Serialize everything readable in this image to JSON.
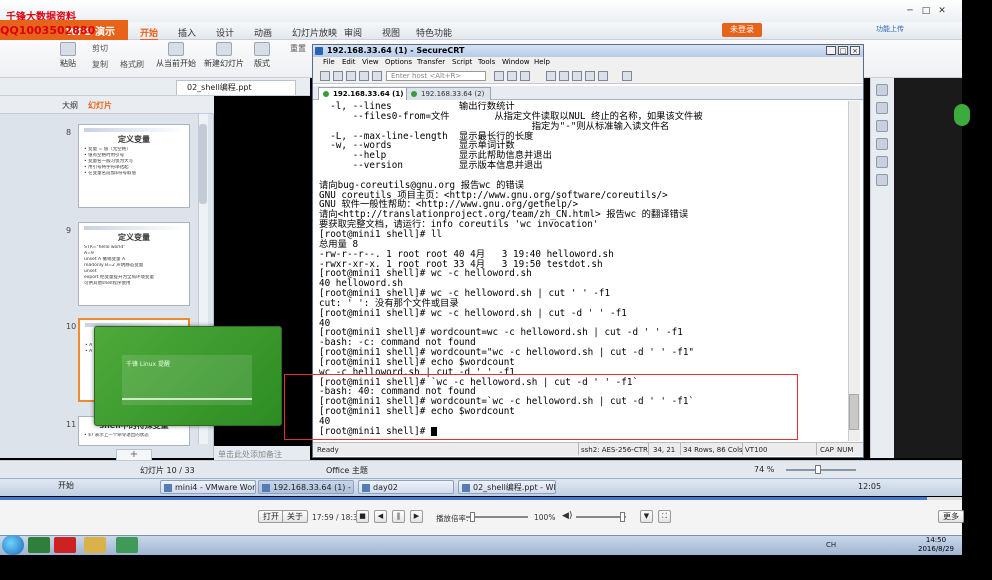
{
  "watermark": {
    "line1": "千锋大数据资料",
    "line2": "QQ1003502880"
  },
  "wps": {
    "app_button": "WPS 演示",
    "tabs": [
      "开始",
      "插入",
      "设计",
      "动画",
      "幻灯片放映",
      "审阅",
      "视图",
      "特色功能"
    ],
    "active_tab": "开始",
    "login_button": "未登录",
    "cloud_label": "功能上传",
    "ribbon": {
      "paste": "粘贴",
      "cut": "剪切",
      "copy": "复制",
      "format_painter": "格式刷",
      "from_current": "从当前开始",
      "new_slide": "新建幻灯片",
      "layout": "版式",
      "reset": "重置"
    },
    "doc_tab": "02_shell编程.ppt",
    "panel_tabs": {
      "outline": "大纲",
      "slides": "幻灯片"
    },
    "notes_placeholder": "单击此处添加备注",
    "status": {
      "slide_index": "幻灯片 10 / 33",
      "theme": "Office 主题",
      "zoom": "74 %"
    }
  },
  "slides": [
    {
      "num": "8",
      "title": "定义变量",
      "lines": [
        "• 变量 = 值（无空格）",
        "• 值有空格时用引号",
        "• 变量名一般习惯为大写",
        "• 用引号将字符串括起",
        "• 在变量名前加$符号取值"
      ]
    },
    {
      "num": "9",
      "title": "定义变量",
      "lines": [
        "STR=\"hello world\"",
        "A=9",
        "unset A 撤销变量 A",
        "readonly B=2 声明静态变量",
        "unset",
        "export 把变量提升为全局环境变量",
        "可供其他shell程序使用"
      ]
    },
    {
      "num": "10",
      "title": "",
      "lines": [
        "• A",
        "• A"
      ]
    },
    {
      "num": "11",
      "title": "shell中的特殊变量",
      "lines": [
        "• $? 表示上一个命令退出的状态"
      ]
    }
  ],
  "green_popup": {
    "text": "千锋 Linux 提醒"
  },
  "crt": {
    "title": "192.168.33.64 (1) - SecureCRT",
    "menu": [
      "File",
      "Edit",
      "View",
      "Options",
      "Transfer",
      "Script",
      "Tools",
      "Window",
      "Help"
    ],
    "host_placeholder": "Enter host <Alt+R>",
    "tabs": [
      "192.168.33.64 (1)",
      "192.168.33.64 (2)"
    ],
    "status": {
      "ready": "Ready",
      "cipher": "ssh2: AES-256-CTR",
      "cursor": "34, 21",
      "size": "34 Rows, 86 Cols",
      "term": "VT100",
      "caps": "CAP",
      "num": "NUM"
    }
  },
  "terminal_lines": [
    "  -l, --lines            输出行数统计",
    "      --files0-from=文件        从指定文件读取以NUL 终止的名称，如果该文件被",
    "                                      指定为\"-\"则从标准输入读文件名",
    "  -L, --max-line-length  显示最长行的长度",
    "  -w, --words            显示单词计数",
    "      --help             显示此帮助信息并退出",
    "      --version          显示版本信息并退出",
    "",
    "请向bug-coreutils@gnu.org 报告wc 的错误",
    "GNU coreutils 项目主页：<http://www.gnu.org/software/coreutils/>",
    "GNU 软件一般性帮助：<http://www.gnu.org/gethelp/>",
    "请向<http://translationproject.org/team/zh_CN.html> 报告wc 的翻译错误",
    "要获取完整文档，请运行：info coreutils 'wc invocation'",
    "[root@mini1 shell]# ll",
    "总用量 8",
    "-rw-r--r--. 1 root root 40 4月   3 19:40 helloword.sh",
    "-rwxr-xr-x. 1 root root 33 4月   3 19:50 testdot.sh",
    "[root@mini1 shell]# wc -c helloword.sh",
    "40 helloword.sh",
    "[root@mini1 shell]# wc -c helloword.sh | cut ' ' -f1",
    "cut: ' ': 没有那个文件或目录",
    "[root@mini1 shell]# wc -c helloword.sh | cut -d ' ' -f1",
    "40",
    "[root@mini1 shell]# wordcount=wc -c helloword.sh | cut -d ' ' -f1",
    "-bash: -c: command not found",
    "[root@mini1 shell]# wordcount=\"wc -c helloword.sh | cut -d ' ' -f1\"",
    "[root@mini1 shell]# echo $wordcount",
    "wc -c helloword.sh | cut -d ' ' -f1",
    "[root@mini1 shell]# `wc -c helloword.sh | cut -d ' ' -f1`",
    "-bash: 40: command not found",
    "[root@mini1 shell]# wordcount=`wc -c helloword.sh | cut -d ' ' -f1`",
    "[root@mini1 shell]# echo $wordcount",
    "40",
    "[root@mini1 shell]# "
  ],
  "taskbar1": {
    "start": "开始",
    "items": [
      "mini4 - VMware Workstat...",
      "192.168.33.64 (1) - S...",
      "day02",
      "02_shell编程.ppt - WPS ..."
    ],
    "clock": "12:05"
  },
  "player": {
    "open": "打开",
    "close": "关于",
    "time": "17:59 / 18:37",
    "speed_label": "播放倍率:",
    "volume": "100%",
    "more": "更多",
    "progress": 0.964
  },
  "taskbar2": {
    "clock_time": "14:50",
    "clock_date": "2016/8/29",
    "tray": "CH"
  }
}
